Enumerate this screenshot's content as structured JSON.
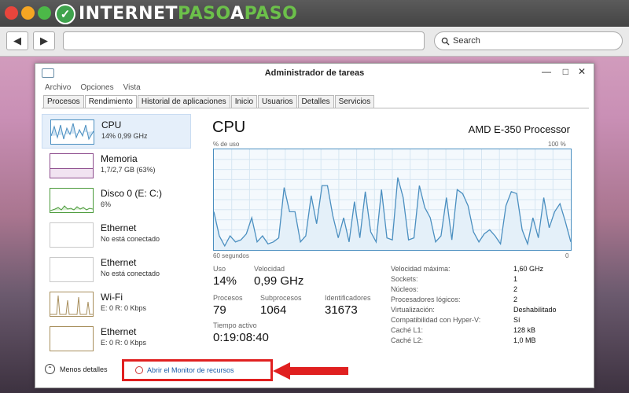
{
  "browser": {
    "logo_part1": "INTERNET",
    "logo_part2": "PASO",
    "logo_part3": "A",
    "logo_part4": "PASO",
    "back_icon": "◀",
    "forward_icon": "▶",
    "search_placeholder": "Search"
  },
  "window": {
    "title": "Administrador de tareas",
    "menu": [
      "Archivo",
      "Opciones",
      "Vista"
    ],
    "tabs": [
      "Procesos",
      "Rendimiento",
      "Historial de aplicaciones",
      "Inicio",
      "Usuarios",
      "Detalles",
      "Servicios"
    ],
    "active_tab": "Rendimiento"
  },
  "sidebar": {
    "items": [
      {
        "name": "CPU",
        "sub": "14% 0,99 GHz"
      },
      {
        "name": "Memoria",
        "sub": "1,7/2,7 GB (63%)"
      },
      {
        "name": "Disco 0 (E: C:)",
        "sub": "6%"
      },
      {
        "name": "Ethernet",
        "sub": "No está conectado"
      },
      {
        "name": "Ethernet",
        "sub": "No está conectado"
      },
      {
        "name": "Wi-Fi",
        "sub": "E: 0 R: 0 Kbps"
      },
      {
        "name": "Ethernet",
        "sub": "E: 0 R: 0 Kbps"
      }
    ]
  },
  "main": {
    "title": "CPU",
    "processor": "AMD E-350 Processor",
    "y_label": "% de uso",
    "y_max": "100 %",
    "x_label": "60 segundos",
    "x_min": "0",
    "stats": {
      "uso_label": "Uso",
      "uso_value": "14%",
      "velocidad_label": "Velocidad",
      "velocidad_value": "0,99 GHz",
      "procesos_label": "Procesos",
      "procesos_value": "79",
      "subprocesos_label": "Subprocesos",
      "subprocesos_value": "1064",
      "identificadores_label": "Identificadores",
      "identificadores_value": "31673",
      "tiempo_label": "Tiempo activo",
      "tiempo_value": "0:19:08:40"
    },
    "details": [
      {
        "k": "Velocidad máxima:",
        "v": "1,60 GHz"
      },
      {
        "k": "Sockets:",
        "v": "1"
      },
      {
        "k": "Núcleos:",
        "v": "2"
      },
      {
        "k": "Procesadores lógicos:",
        "v": "2"
      },
      {
        "k": "Virtualización:",
        "v": "Deshabilitado"
      },
      {
        "k": "Compatibilidad con Hyper-V:",
        "v": "Sí"
      },
      {
        "k": "Caché L1:",
        "v": "128 kB"
      },
      {
        "k": "Caché L2:",
        "v": "1,0 MB"
      }
    ]
  },
  "footer": {
    "less_details": "Menos detalles",
    "open_monitor": "Abrir el Monitor de recursos"
  },
  "cpu_usage_series": [
    38,
    14,
    4,
    14,
    8,
    10,
    16,
    32,
    8,
    14,
    6,
    8,
    12,
    62,
    38,
    38,
    8,
    14,
    54,
    26,
    64,
    64,
    34,
    12,
    32,
    8,
    48,
    12,
    58,
    18,
    8,
    60,
    12,
    10,
    72,
    52,
    10,
    12,
    64,
    42,
    32,
    8,
    14,
    52,
    10,
    60,
    56,
    44,
    18,
    8,
    16,
    20,
    14,
    6,
    44,
    58,
    56,
    20,
    6,
    32,
    12,
    52,
    22,
    38,
    46,
    28,
    8
  ],
  "colors": {
    "cpu_line": "#4b8fc0",
    "accent_red": "#e02020"
  }
}
